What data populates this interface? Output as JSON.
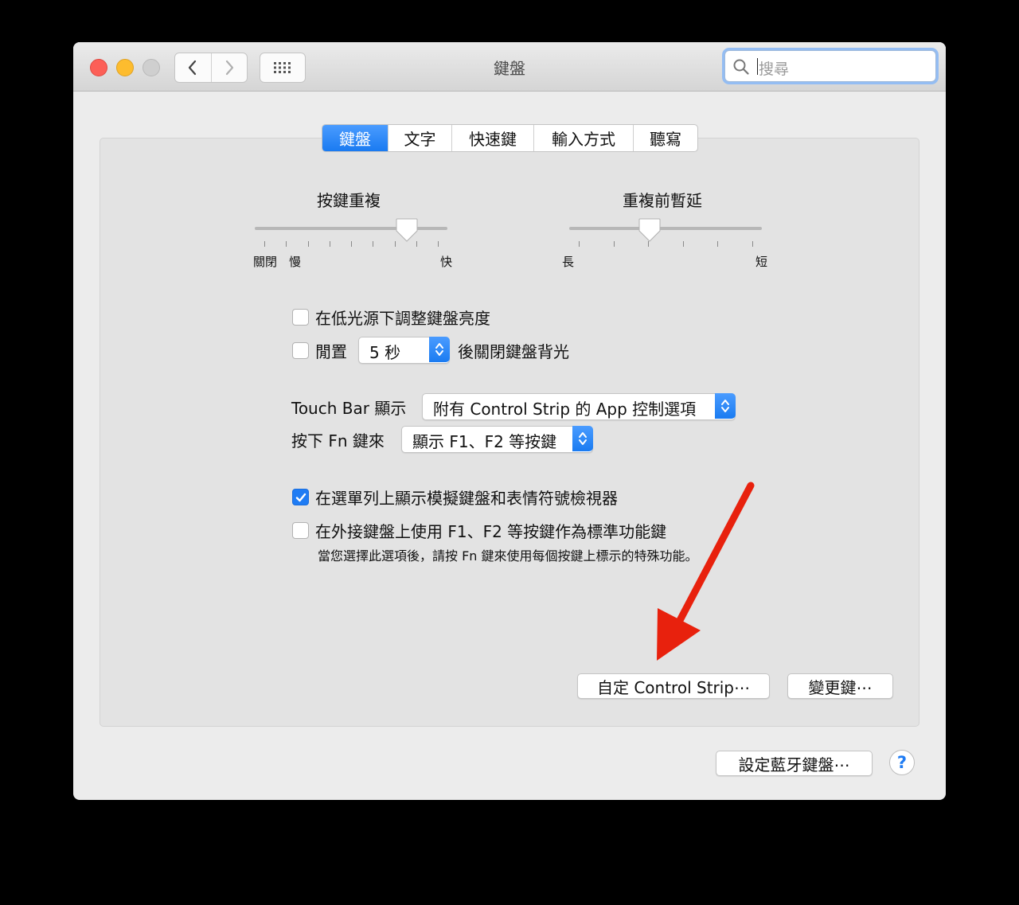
{
  "window": {
    "title": "鍵盤",
    "search_placeholder": "搜尋"
  },
  "tabs": [
    {
      "label": "鍵盤",
      "active": true
    },
    {
      "label": "文字",
      "active": false
    },
    {
      "label": "快速鍵",
      "active": false
    },
    {
      "label": "輸入方式",
      "active": false
    },
    {
      "label": "聽寫",
      "active": false
    }
  ],
  "key_repeat": {
    "title": "按鍵重複",
    "labels": {
      "off": "關閉",
      "slow": "慢",
      "fast": "快"
    },
    "value": 0.82
  },
  "repeat_delay": {
    "title": "重複前暫延",
    "labels": {
      "long": "長",
      "short": "短"
    },
    "value": 0.41
  },
  "options": {
    "brightness": {
      "label": "在低光源下調整鍵盤亮度",
      "checked": false
    },
    "idle": {
      "label": "閒置",
      "value": "5 秒",
      "suffix": "後關閉鍵盤背光",
      "checked": false
    }
  },
  "touchbar": {
    "label": "Touch Bar 顯示",
    "value": "附有 Control Strip 的 App 控制選項"
  },
  "fn": {
    "label": "按下 Fn 鍵來",
    "value": "顯示 F1、F2 等按鍵"
  },
  "checks": {
    "viewer": {
      "label": "在選單列上顯示模擬鍵盤和表情符號檢視器",
      "checked": true
    },
    "fkeys": {
      "label": "在外接鍵盤上使用 F1、F2 等按鍵作為標準功能鍵",
      "checked": false
    },
    "fkeys_note": "當您選擇此選項後，請按 Fn 鍵來使用每個按鍵上標示的特殊功能。"
  },
  "buttons": {
    "customize": "自定 Control Strip⋯",
    "modifier": "變更鍵⋯",
    "bluetooth": "設定藍牙鍵盤⋯",
    "help": "?"
  },
  "colors": {
    "accent": "#1f7cf4",
    "annotation_arrow": "#e8210d"
  }
}
